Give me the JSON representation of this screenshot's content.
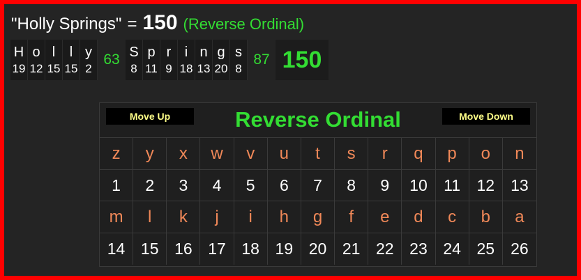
{
  "headline": {
    "phrase": "\"Holly Springs\"",
    "equals": "=",
    "value": "150",
    "cipher_label": "(Reverse Ordinal)"
  },
  "breakdown": {
    "words": [
      {
        "letters": [
          {
            "char": "H",
            "value": "19"
          },
          {
            "char": "o",
            "value": "12"
          },
          {
            "char": "l",
            "value": "15"
          },
          {
            "char": "l",
            "value": "15"
          },
          {
            "char": "y",
            "value": "2"
          }
        ],
        "sum": "63"
      },
      {
        "letters": [
          {
            "char": "S",
            "value": "8"
          },
          {
            "char": "p",
            "value": "11"
          },
          {
            "char": "r",
            "value": "9"
          },
          {
            "char": "i",
            "value": "18"
          },
          {
            "char": "n",
            "value": "13"
          },
          {
            "char": "g",
            "value": "20"
          },
          {
            "char": "s",
            "value": "8"
          }
        ],
        "sum": "87"
      }
    ],
    "total": "150"
  },
  "cipher": {
    "title": "Reverse Ordinal",
    "move_up_label": "Move Up",
    "move_down_label": "Move Down",
    "rows": [
      {
        "letters": [
          "z",
          "y",
          "x",
          "w",
          "v",
          "u",
          "t",
          "s",
          "r",
          "q",
          "p",
          "o",
          "n"
        ],
        "numbers": [
          "1",
          "2",
          "3",
          "4",
          "5",
          "6",
          "7",
          "8",
          "9",
          "10",
          "11",
          "12",
          "13"
        ]
      },
      {
        "letters": [
          "m",
          "l",
          "k",
          "j",
          "i",
          "h",
          "g",
          "f",
          "e",
          "d",
          "c",
          "b",
          "a"
        ],
        "numbers": [
          "14",
          "15",
          "16",
          "17",
          "18",
          "19",
          "20",
          "21",
          "22",
          "23",
          "24",
          "25",
          "26"
        ]
      }
    ]
  }
}
